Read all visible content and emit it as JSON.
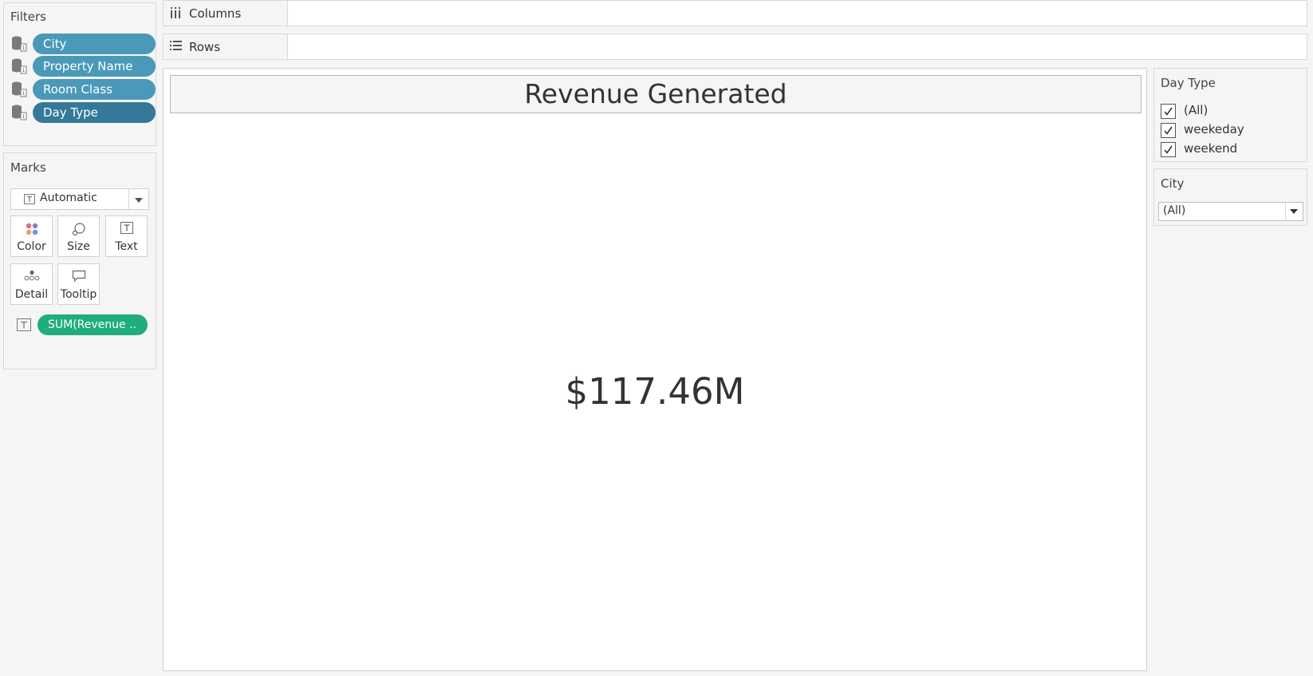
{
  "filters": {
    "title": "Filters",
    "items": [
      {
        "label": "City",
        "icon": "database-icon"
      },
      {
        "label": "Property Name",
        "icon": "database-icon"
      },
      {
        "label": "Room Class",
        "icon": "database-icon"
      },
      {
        "label": "Day Type",
        "icon": "database-icon"
      }
    ],
    "pill_color": "#4a99b8",
    "pill_color_active": "#35799a"
  },
  "marks": {
    "title": "Marks",
    "mark_type": "Automatic",
    "buttons": [
      {
        "label": "Color",
        "icon": "color-icon"
      },
      {
        "label": "Size",
        "icon": "size-icon"
      },
      {
        "label": "Text",
        "icon": "text-icon"
      },
      {
        "label": "Detail",
        "icon": "detail-icon"
      },
      {
        "label": "Tooltip",
        "icon": "tooltip-icon"
      }
    ],
    "field": "SUM(Revenue ..",
    "field_color": "#1fad7c"
  },
  "shelves": {
    "columns_label": "Columns",
    "rows_label": "Rows"
  },
  "viz": {
    "title": "Revenue Generated",
    "kpi_value": "$117.46M"
  },
  "day_type_filter": {
    "title": "Day Type",
    "options": [
      {
        "label": "(All)",
        "checked": true
      },
      {
        "label": "weekeday",
        "checked": true
      },
      {
        "label": "weekend",
        "checked": true
      }
    ]
  },
  "city_filter": {
    "title": "City",
    "selected": "(All)"
  }
}
